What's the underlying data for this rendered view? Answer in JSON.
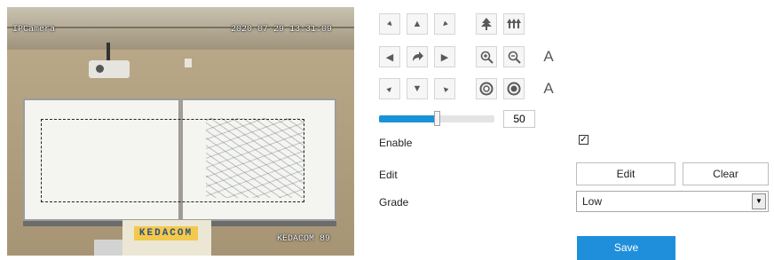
{
  "preview": {
    "osd_channel": "IPCamera",
    "osd_datetime": "2020-07-29 13:31:09",
    "osd_footer": "KEDACOM 89",
    "podium_logo": "KEDACOM"
  },
  "ptz": {
    "up_left": "▼",
    "up": "▲",
    "up_right": "▼",
    "left": "◀",
    "auto_scan": "↷",
    "right": "▶",
    "down_left": "▲",
    "down": "▼",
    "down_right": "▲",
    "focus_near": "▲",
    "focus_far": "ꟷ",
    "zoom_in": "⊕",
    "zoom_out": "⊖",
    "focus_auto": "A",
    "iris_open": "O",
    "iris_close": "O",
    "iris_auto": "A"
  },
  "speed": {
    "value": "50",
    "level_fraction": 0.5
  },
  "form": {
    "enable_label": "Enable",
    "enable_checked": "✓",
    "edit_label": "Edit",
    "edit_button": "Edit",
    "clear_button": "Clear",
    "grade_label": "Grade",
    "grade_value": "Low",
    "grade_arrow": "▼",
    "save_button": "Save"
  },
  "colors": {
    "accent": "#1f8fdb",
    "slider_fill": "#1a92d6"
  }
}
